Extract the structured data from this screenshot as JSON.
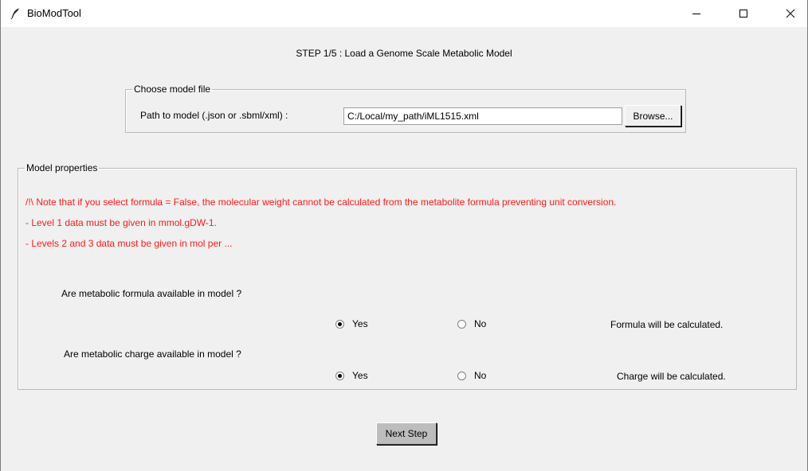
{
  "window": {
    "title": "BioModTool",
    "icon": "feather-icon",
    "controls": [
      "minimize-icon",
      "maximize-icon",
      "close-icon"
    ]
  },
  "step_title": "STEP 1/5 : Load a Genome Scale Metabolic Model",
  "model_file_group": {
    "legend": "Choose model file",
    "path_label": "Path to model (.json or .sbml/xml) :",
    "path_value": "C:/Local/my_path/iML1515.xml",
    "browse_label": "Browse..."
  },
  "model_properties": {
    "legend": "Model properties",
    "warning_color": "#ff1a1a",
    "warnings": [
      "/!\\ Note that if you select formula = False, the molecular weight cannot be calculated from the metabolite formula preventing unit conversion.",
      "- Level 1 data must be given in mmol.gDW-1.",
      "- Levels 2 and 3 data must be given in mol per ..."
    ],
    "formula": {
      "question": "Are metabolic formula available in model ?",
      "yes_label": "Yes",
      "no_label": "No",
      "selected": "Yes",
      "status": "Formula will be calculated."
    },
    "charge": {
      "question": "Are metabolic charge available in model ?",
      "yes_label": "Yes",
      "no_label": "No",
      "selected": "Yes",
      "status": "Charge will be calculated."
    }
  },
  "next_button_label": "Next Step"
}
